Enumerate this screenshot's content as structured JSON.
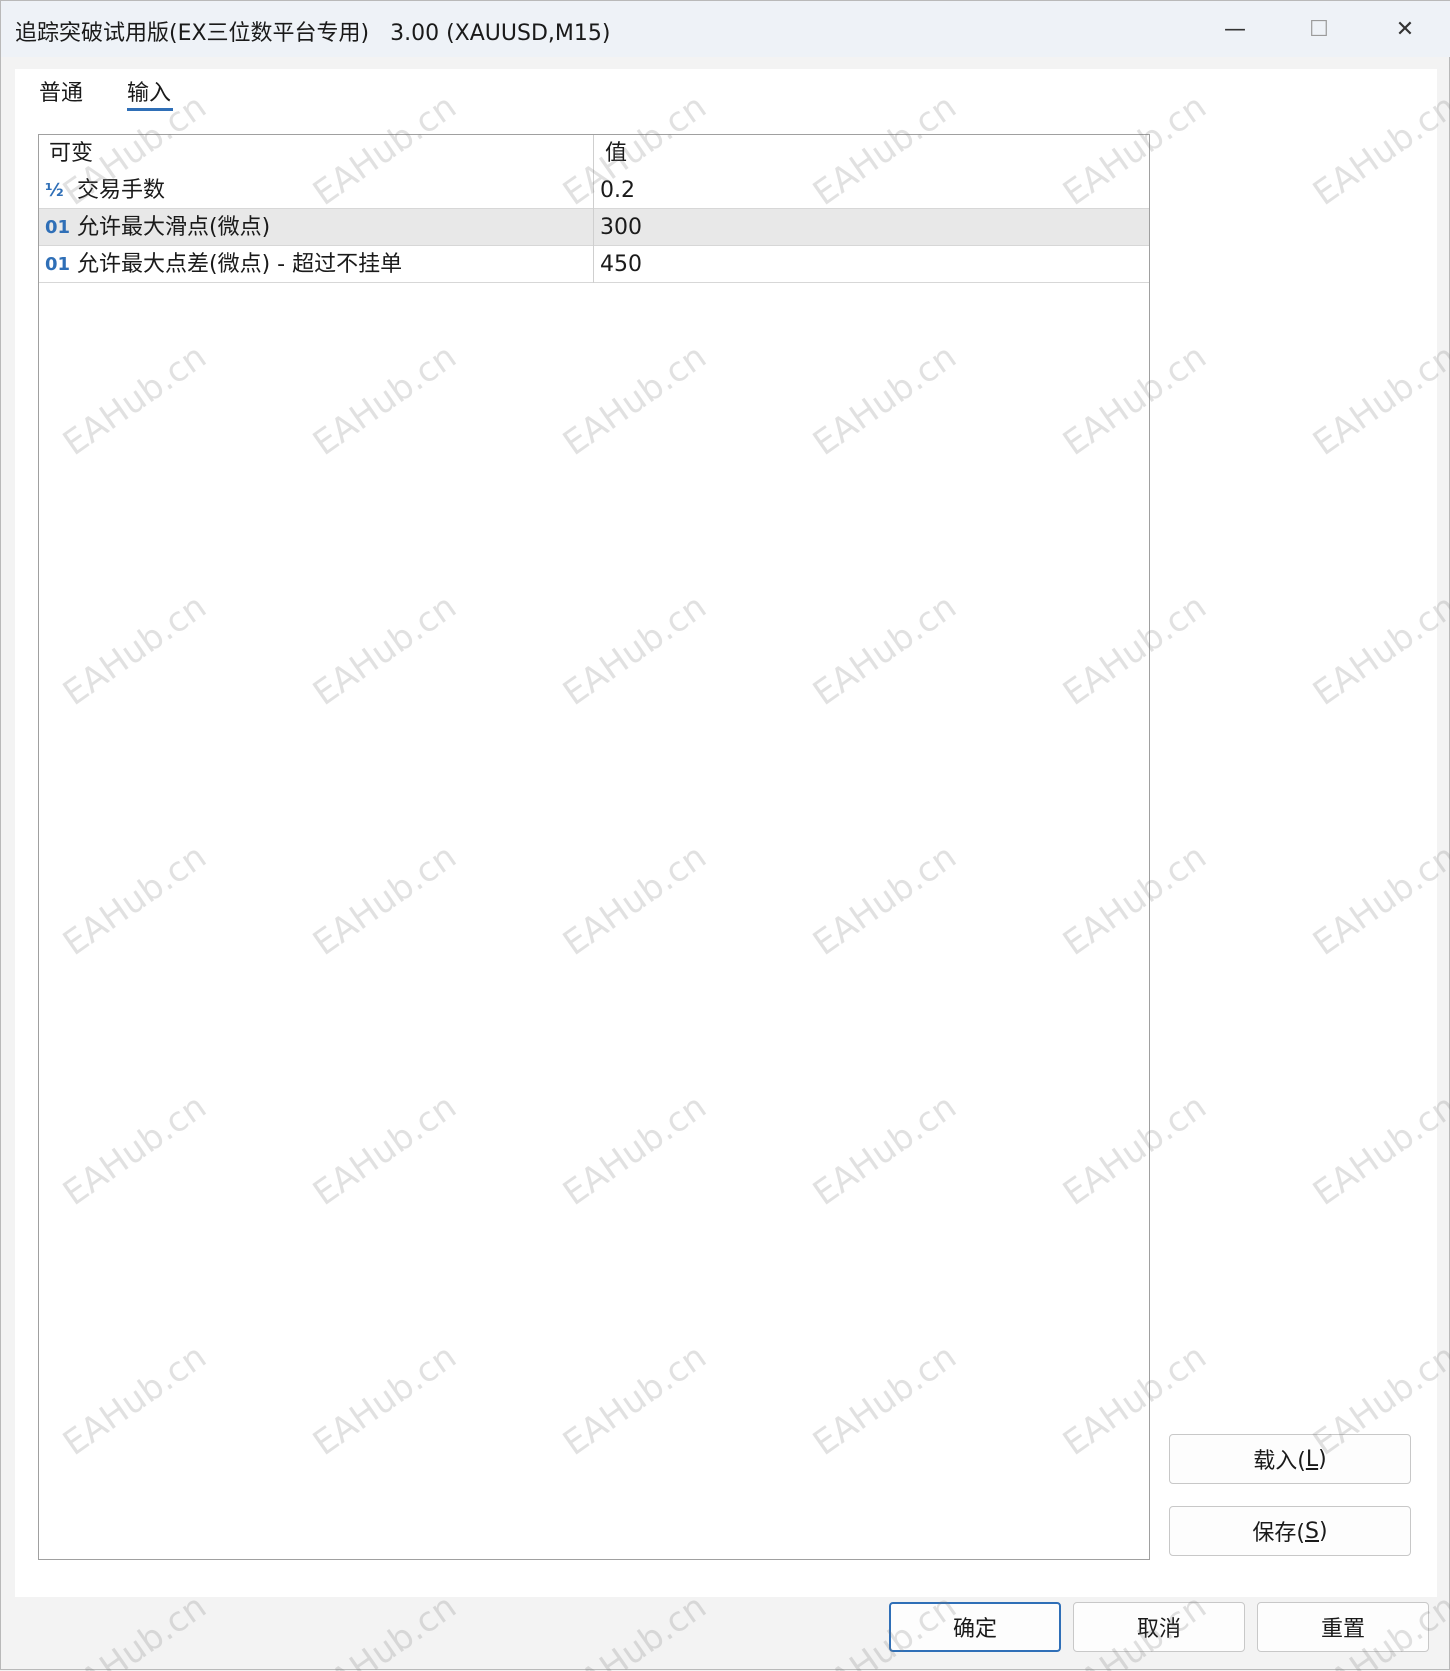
{
  "window": {
    "title": "追踪突破试用版(EX三位数平台专用)   3.00 (XAUUSD,M15)",
    "controls": {
      "minimize": "—",
      "maximize": "☐",
      "close": "✕"
    }
  },
  "tabs": [
    {
      "label": "普通"
    },
    {
      "label": "输入",
      "active": true
    }
  ],
  "grid": {
    "headers": {
      "variable": "可变",
      "value": "值"
    },
    "rows": [
      {
        "icon": "½",
        "icon_name": "fraction-icon",
        "name": "交易手数",
        "value": "0.2"
      },
      {
        "icon": "01",
        "icon_name": "integer-icon",
        "name": "允许最大滑点(微点)",
        "value": "300"
      },
      {
        "icon": "01",
        "icon_name": "integer-icon",
        "name": "允许最大点差(微点) - 超过不挂单",
        "value": "450"
      }
    ]
  },
  "side_buttons": {
    "load": {
      "text": "载入(",
      "key": "L",
      "end": ")"
    },
    "save": {
      "text": "保存(",
      "key": "S",
      "end": ")"
    }
  },
  "bottom_buttons": {
    "ok": "确定",
    "cancel": "取消",
    "reset": "重置"
  },
  "watermark": "EAHub.cn",
  "colors": {
    "accent": "#2f6fb7",
    "titlebar": "#eef2f7",
    "selected_row": "#e8e8e8"
  }
}
